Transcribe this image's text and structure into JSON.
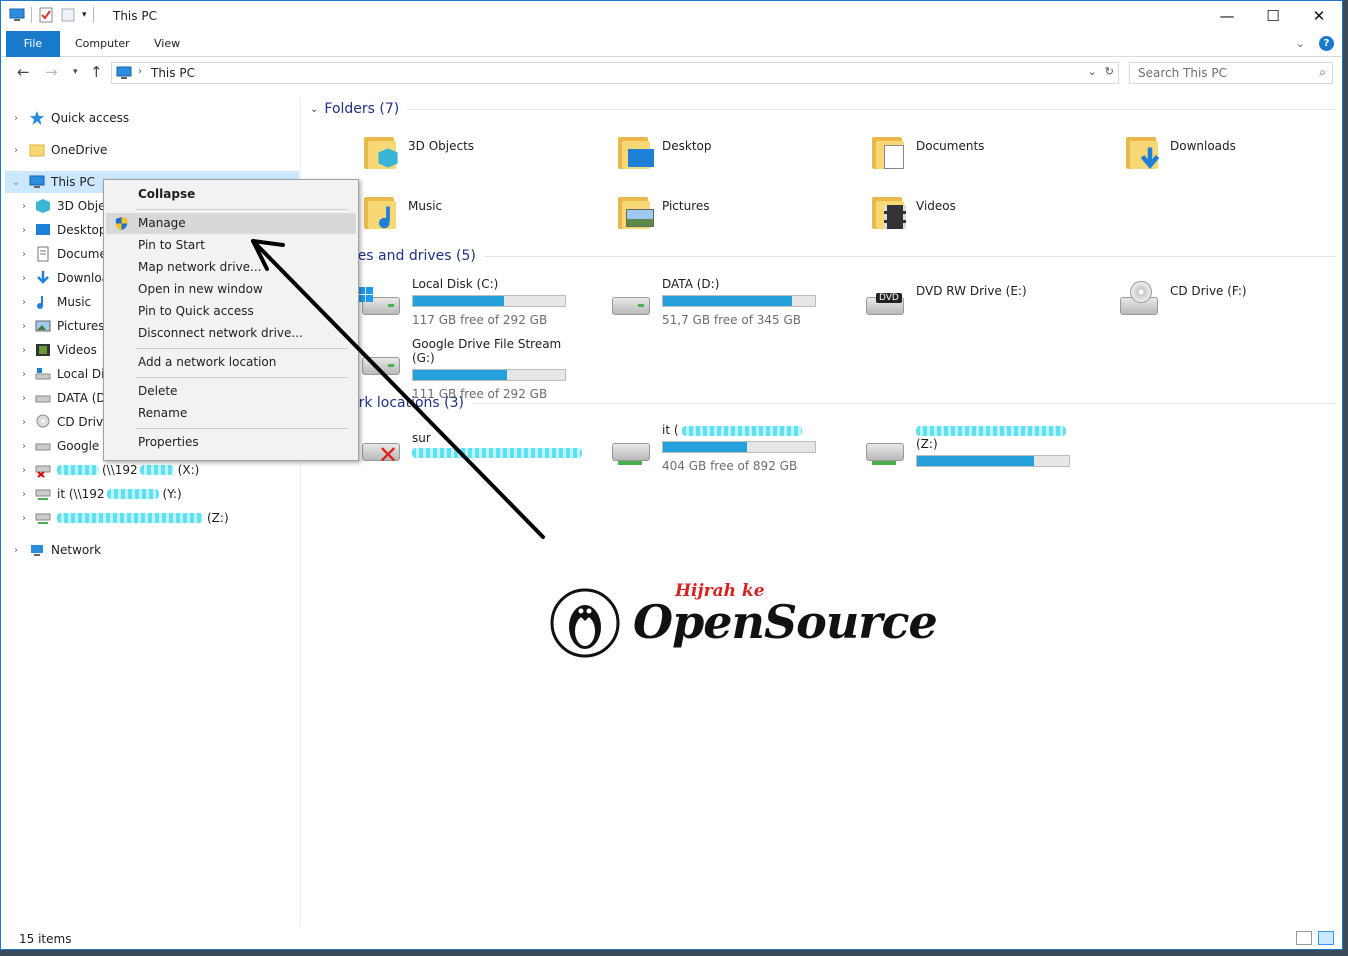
{
  "window": {
    "title": "This PC"
  },
  "window_controls": {
    "minimize": "—",
    "maximize": "☐",
    "close": "✕"
  },
  "ribbon": {
    "tabs": [
      "File",
      "Computer",
      "View"
    ],
    "help": "?"
  },
  "address_bar": {
    "path": "This PC",
    "search_placeholder": "Search This PC"
  },
  "nav_pane": {
    "items": [
      {
        "label": "Quick access",
        "icon": "star-icon"
      },
      {
        "label": "OneDrive",
        "icon": "folder-icon"
      },
      {
        "label": "This PC",
        "icon": "computer-icon"
      },
      {
        "label": "3D Objec",
        "icon": "cube-icon"
      },
      {
        "label": "Desktop",
        "icon": "desktop-icon"
      },
      {
        "label": "Docume",
        "icon": "document-icon"
      },
      {
        "label": "Downloa",
        "icon": "download-icon"
      },
      {
        "label": "Music",
        "icon": "music-icon"
      },
      {
        "label": "Pictures",
        "icon": "pictures-icon"
      },
      {
        "label": "Videos",
        "icon": "videos-icon"
      },
      {
        "label": "Local Dis",
        "icon": "drive-icon"
      },
      {
        "label": "DATA (D",
        "icon": "drive-icon"
      },
      {
        "label": "CD Drive",
        "icon": "cd-icon"
      },
      {
        "label": "Google D",
        "icon": "drive-icon"
      },
      {
        "label": "(\\\\192",
        "suffix": "(X:)",
        "icon": "network-drive-disconnected-icon"
      },
      {
        "label": "it (\\\\192",
        "suffix": "(Y:)",
        "icon": "network-drive-icon"
      },
      {
        "label": "",
        "suffix": "(Z:)",
        "icon": "network-drive-icon"
      },
      {
        "label": "Network",
        "icon": "network-icon"
      }
    ]
  },
  "context_menu": {
    "items": [
      "Collapse",
      "Manage",
      "Pin to Start",
      "Map network drive...",
      "Open in new window",
      "Pin to Quick access",
      "Disconnect network drive...",
      "Add a network location",
      "Delete",
      "Rename",
      "Properties"
    ]
  },
  "content": {
    "folders_header": "Folders (7)",
    "folders": [
      "3D Objects",
      "Desktop",
      "Documents",
      "Downloads",
      "Music",
      "Pictures",
      "Videos"
    ],
    "drives_header": "ces and drives (5)",
    "drives": [
      {
        "name": "Local Disk (C:)",
        "free": "117 GB free of 292 GB",
        "used_fraction": 0.6
      },
      {
        "name": "DATA (D:)",
        "free": "51,7 GB free of 345 GB",
        "used_fraction": 0.85
      },
      {
        "name": "DVD RW Drive (E:)",
        "badge": "DVD"
      },
      {
        "name": "CD Drive (F:)"
      },
      {
        "name": "Google Drive File Stream (G:)",
        "free": "111 GB free of 292 GB",
        "used_fraction": 0.62
      }
    ],
    "network_header": "ork locations (3)",
    "network": [
      {
        "name": "sur",
        "disconnected": true
      },
      {
        "name": "it (",
        "free": "404 GB free of 892 GB",
        "used_fraction": 0.55
      },
      {
        "name": "(Z:)",
        "used_fraction": 0.77
      }
    ]
  },
  "status_bar": {
    "count": "15 items"
  },
  "watermark": {
    "top": "Hijrah ke",
    "main": "OpenSource"
  },
  "colors": {
    "accent": "#1979ca",
    "bar_fill": "#26a0da",
    "header_text": "#1e3287"
  }
}
